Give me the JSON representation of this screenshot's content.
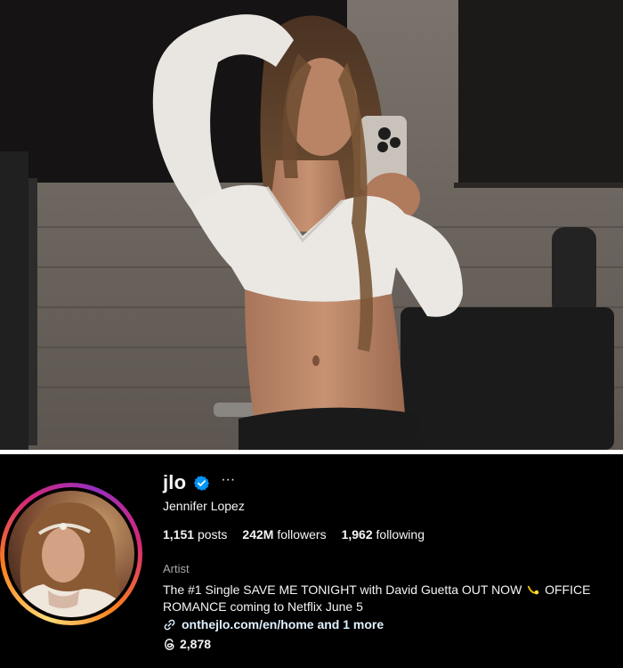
{
  "profile": {
    "username": "jlo",
    "more_icon_glyph": "···",
    "full_name": "Jennifer Lopez",
    "stats": {
      "posts_count": "1,151",
      "posts_label": "posts",
      "followers_count": "242M",
      "followers_label": "followers",
      "following_count": "1,962",
      "following_label": "following"
    },
    "category": "Artist",
    "bio_line1_before": "The #1 Single SAVE ME TONIGHT with David Guetta OUT NOW",
    "bio_line1_after": "OFFICE",
    "bio_line2": "ROMANCE coming to Netflix June 5",
    "link_text": "onthejlo.com/en/home and 1 more",
    "threads_count": "2,878"
  },
  "icons": {
    "verified": "verified-badge-icon",
    "more": "more-options-icon",
    "bio_emoji": "comet-emoji-icon",
    "link": "link-icon",
    "threads": "threads-icon"
  },
  "colors": {
    "panel_background": "#000000",
    "primary_text": "#f5f5f5",
    "secondary_text": "#a8a8a8",
    "link_text": "#e0f1ff",
    "verified_blue": "#0095f6",
    "story_ring_gradient": [
      "#feda75",
      "#fa7e1e",
      "#d62976",
      "#962fbf"
    ]
  }
}
